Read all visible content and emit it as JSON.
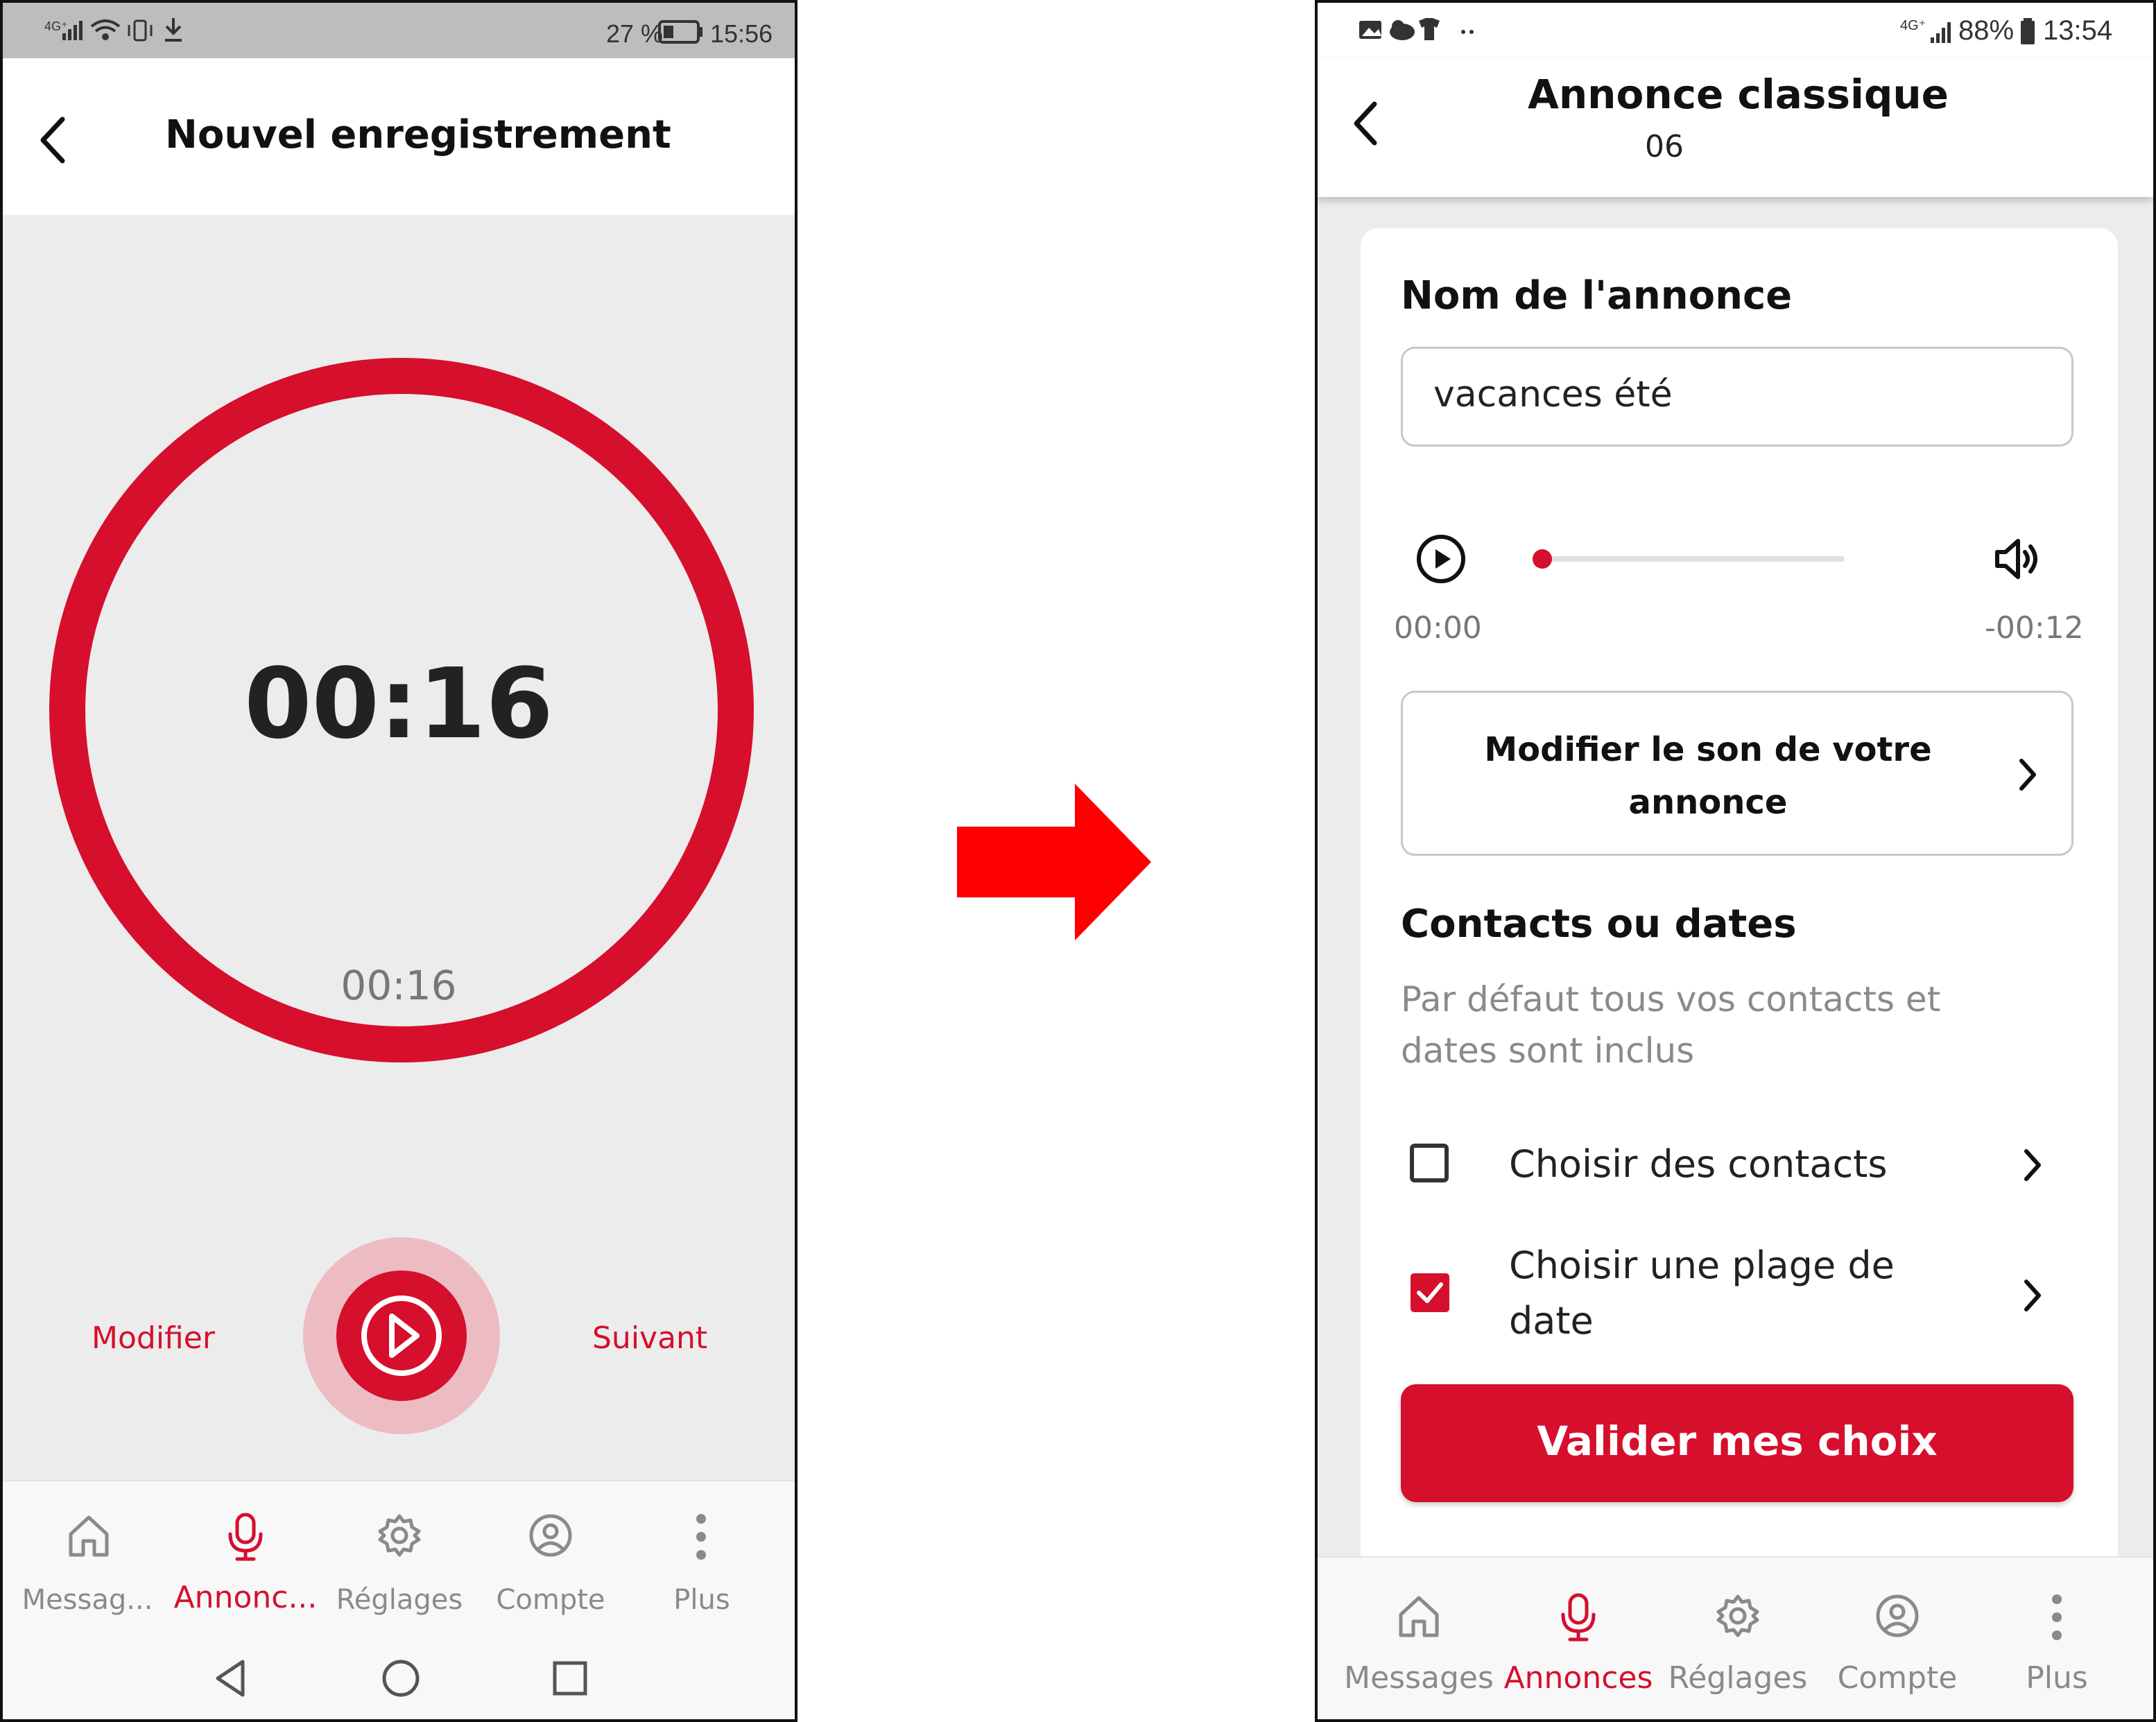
{
  "colors": {
    "accent": "#d50f2c",
    "accent_light": "#edbcc2",
    "gray_bg": "#ececec",
    "arrow": "#ff0000"
  },
  "left_screen": {
    "status_bar": {
      "network": "4G⁺",
      "battery": "27 %",
      "time": "15:56"
    },
    "header": {
      "back_icon": "chevron-left-icon",
      "title": "Nouvel enregistrement"
    },
    "timer": {
      "elapsed_big": "00:16",
      "elapsed_small": "00:16"
    },
    "actions": {
      "modify": "Modifier",
      "play_icon": "play-icon",
      "next": "Suivant"
    },
    "bottom_nav": [
      {
        "label": "Messag...",
        "icon": "home-icon",
        "active": false
      },
      {
        "label": "Annonc...",
        "icon": "microphone-icon",
        "active": true
      },
      {
        "label": "Réglages",
        "icon": "gear-icon",
        "active": false
      },
      {
        "label": "Compte",
        "icon": "user-circle-icon",
        "active": false
      },
      {
        "label": "Plus",
        "icon": "more-vertical-icon",
        "active": false
      }
    ],
    "system_nav": [
      "back-triangle-icon",
      "home-circle-icon",
      "recents-square-icon"
    ]
  },
  "right_screen": {
    "status_bar": {
      "network": "4G⁺",
      "battery": "88%",
      "time": "13:54"
    },
    "header": {
      "title": "Annonce classique",
      "subtitle": "06"
    },
    "name_section": {
      "heading": "Nom de l'annonce",
      "value": "vacances été"
    },
    "player": {
      "current": "00:00",
      "remaining": "-00:12",
      "progress": 0
    },
    "modify_sound": {
      "label": "Modifier le son de votre annonce"
    },
    "contacts_section": {
      "heading": "Contacts ou dates",
      "description": "Par défaut tous vos contacts et dates sont inclus",
      "options": [
        {
          "label": "Choisir des contacts",
          "checked": false
        },
        {
          "label_line1": "Choisir une plage de",
          "label_line2": "date",
          "checked": true
        }
      ]
    },
    "validate_button": "Valider mes choix",
    "bottom_nav": [
      {
        "label": "Messages",
        "icon": "home-icon",
        "active": false
      },
      {
        "label": "Annonces",
        "icon": "microphone-icon",
        "active": true
      },
      {
        "label": "Réglages",
        "icon": "gear-icon",
        "active": false
      },
      {
        "label": "Compte",
        "icon": "user-circle-icon",
        "active": false
      },
      {
        "label": "Plus",
        "icon": "more-vertical-icon",
        "active": false
      }
    ]
  }
}
